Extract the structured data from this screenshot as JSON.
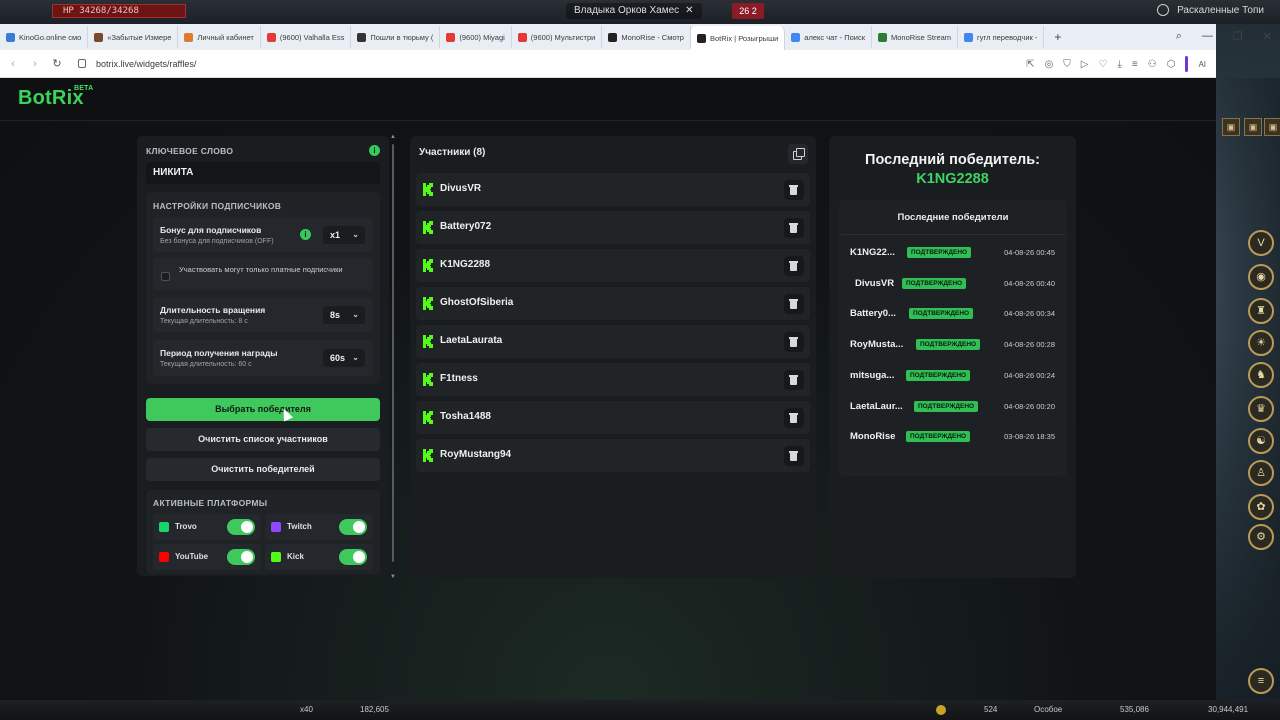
{
  "game": {
    "hp_text": "HP 34268/34268",
    "window_title": "Владыка Орков Хамес",
    "badge": "26 2",
    "location": "Раскаленные Топи",
    "bottom": {
      "ammo": "x40",
      "value1": "182,605",
      "count": "524",
      "mode": "Особое",
      "value2": "535,086",
      "value3": "30,944,491"
    }
  },
  "browser": {
    "tabs": [
      {
        "label": "KinoGo.online смо",
        "color": "#3a7bd5"
      },
      {
        "label": "«Забытые Измере",
        "color": "#7a4b2a"
      },
      {
        "label": "Личный кабинет",
        "color": "#e07a2e"
      },
      {
        "label": "(9600) Valhalla Ess",
        "color": "#e53935"
      },
      {
        "label": "Пошли в тюрьму (",
        "color": "#333333"
      },
      {
        "label": "(9600) Miyagi",
        "color": "#e53935"
      },
      {
        "label": "(9600) Мультистри",
        "color": "#e53935"
      },
      {
        "label": "MonoRise - Смотр",
        "color": "#222222"
      },
      {
        "label": "BotRix | Розыгрыши",
        "color": "#222222"
      },
      {
        "label": "алекс чат - Поиск",
        "color": "#4285f4"
      },
      {
        "label": "MonoRise Stream",
        "color": "#2e7d32"
      },
      {
        "label": "гугл переводчик -",
        "color": "#4285f4"
      }
    ],
    "active_tab_index": 8,
    "url": "botrix.live/widgets/raffles/",
    "ai_label": "AI"
  },
  "app": {
    "logo": "BotRix",
    "logo_tag": "BETA"
  },
  "settings": {
    "keyword_label": "КЛЮЧЕВОЕ СЛОВО",
    "keyword_value": "НИКИТА",
    "subs_title": "НАСТРОЙКИ ПОДПИСЧИКОВ",
    "bonus_title": "Бонус для подписчиков",
    "bonus_sub": "Без бонуса для подписчиков (OFF)",
    "bonus_value": "x1",
    "paid_only_label": "Участвовать могут только платные подписчики",
    "spin_title": "Длительность вращения",
    "spin_sub": "Текущая длительность: 8 с",
    "spin_value": "8s",
    "claim_title": "Период получения награды",
    "claim_sub": "Текущая длительность: 60 с",
    "claim_value": "60s",
    "pick_winner": "Выбрать победителя",
    "clear_participants": "Очистить список участников",
    "clear_winners": "Очистить победителей",
    "platforms_title": "АКТИВНЫЕ ПЛАТФОРМЫ",
    "platforms": [
      {
        "name": "Trovo",
        "color": "#19d66b",
        "enabled": true
      },
      {
        "name": "Twitch",
        "color": "#9146ff",
        "enabled": true
      },
      {
        "name": "YouTube",
        "color": "#ff0000",
        "enabled": true
      },
      {
        "name": "Kick",
        "color": "#53fc18",
        "enabled": true
      }
    ]
  },
  "participants": {
    "title": "Участники (8)",
    "list": [
      "DivusVR",
      "Battery072",
      "K1NG2288",
      "GhostOfSiberia",
      "LaetaLaurata",
      "F1tness",
      "Tosha1488",
      "RoyMustang94"
    ]
  },
  "winners": {
    "last_label": "Последний победитель:",
    "last_name": "K1NG2288",
    "recent_title": "Последние победители",
    "badge_text": "ПОДТВЕРЖДЕНО",
    "recent": [
      {
        "name": "K1NG22...",
        "time": "04-08-26 00:45"
      },
      {
        "name": "DivusVR",
        "time": "04-08-26 00:40"
      },
      {
        "name": "Battery0...",
        "time": "04-08-26 00:34"
      },
      {
        "name": "RoyMusta...",
        "time": "04-08-26 00:28"
      },
      {
        "name": "mitsuga...",
        "time": "04-08-26 00:24"
      },
      {
        "name": "LaetaLaur...",
        "time": "04-08-26 00:20"
      },
      {
        "name": "MonoRise",
        "time": "03-08-26 18:35"
      }
    ]
  },
  "colors": {
    "accent": "#3fc95c",
    "panel": "#1a1d20",
    "page_bg": "#111416"
  }
}
